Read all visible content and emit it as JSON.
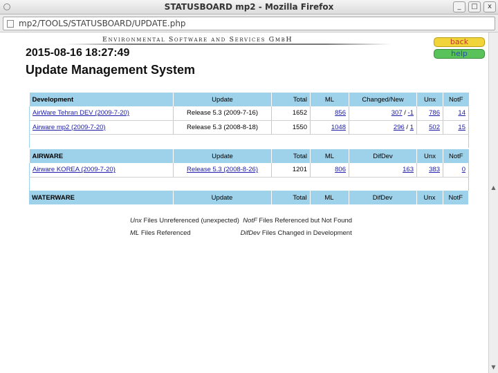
{
  "window": {
    "title": "STATUSBOARD mp2 - Mozilla Firefox",
    "minimize_glyph": "_",
    "maximize_glyph": "□",
    "close_glyph": "x"
  },
  "urlbar": {
    "url": "mp2/TOOLS/STATUSBOARD/UPDATE.php"
  },
  "page": {
    "company": "Environmental Software and Services GmbH",
    "back_label": "back",
    "help_label": "help",
    "datetime": "2015-08-16 18:27:49",
    "title": "Update Management System"
  },
  "sections": [
    {
      "group": "Development",
      "headers": [
        "Update",
        "Total",
        "ML",
        "Changed/New",
        "Unx",
        "NotF"
      ],
      "rows": [
        {
          "name": "AirWare Tehran DEV (2009-7-20)",
          "update": "Release 5.3 (2009-7-16)",
          "total": "1652",
          "ml": "856",
          "changed": "307",
          "sep": " / ",
          "new": "-1",
          "unx": "786",
          "notf": "14"
        },
        {
          "name": "Airware mp2 (2009-7-20)",
          "update": "Release 5.3 (2008-8-18)",
          "total": "1550",
          "ml": "1048",
          "changed": "296",
          "sep": " / ",
          "new": "1",
          "unx": "502",
          "notf": "15"
        }
      ]
    },
    {
      "group": "AIRWARE",
      "headers": [
        "Update",
        "Total",
        "ML",
        "DifDev",
        "Unx",
        "NotF"
      ],
      "rows": [
        {
          "name": "Airware KOREA (2009-7-20)",
          "update": "Release 5.3 (2008-8-26)",
          "total": "1201",
          "ml": "806",
          "difdev": "163",
          "unx": "383",
          "notf": "0"
        }
      ]
    },
    {
      "group": "WATERWARE",
      "headers": [
        "Update",
        "Total",
        "ML",
        "DifDev",
        "Unx",
        "NotF"
      ],
      "rows": []
    }
  ],
  "legend": [
    {
      "key": "Unx",
      "text": " Files Unreferenced (unexpected)",
      "key2": "NotF",
      "text2": " Files Referenced but Not Found"
    },
    {
      "key": "ML",
      "text": " Files Referenced",
      "key2": "DifDev",
      "text2": " Files Changed in Development"
    }
  ],
  "colors": {
    "header_bg": "#9ed2ea",
    "link": "#1a1aa6",
    "back_btn": "#f1d33a",
    "help_btn": "#5ac25a"
  }
}
